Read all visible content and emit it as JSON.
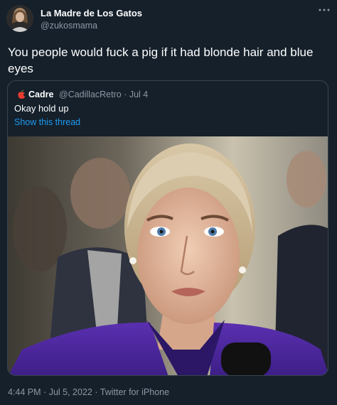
{
  "tweet": {
    "display_name": "La Madre de Los Gatos",
    "handle": "@zukosmama",
    "text": "You people would fuck a pig if it had blonde hair and blue eyes",
    "more_icon": "ellipsis-icon"
  },
  "quoted_tweet": {
    "display_name": "Cadre",
    "handle_and_date": "@CadillacRetro · Jul 4",
    "text": "Okay hold up",
    "show_thread": "Show this thread",
    "name_icon": "bitten-apple-icon",
    "media": "photo-of-woman-in-purple-blazer-at-hearing"
  },
  "footer": {
    "time": "4:44 PM",
    "date": "Jul 5, 2022",
    "client": "Twitter for iPhone",
    "separator": "·"
  },
  "colors": {
    "background": "#15202b",
    "secondary_text": "#8b98a5",
    "link": "#1d9bf0",
    "card_border": "#38444d"
  }
}
